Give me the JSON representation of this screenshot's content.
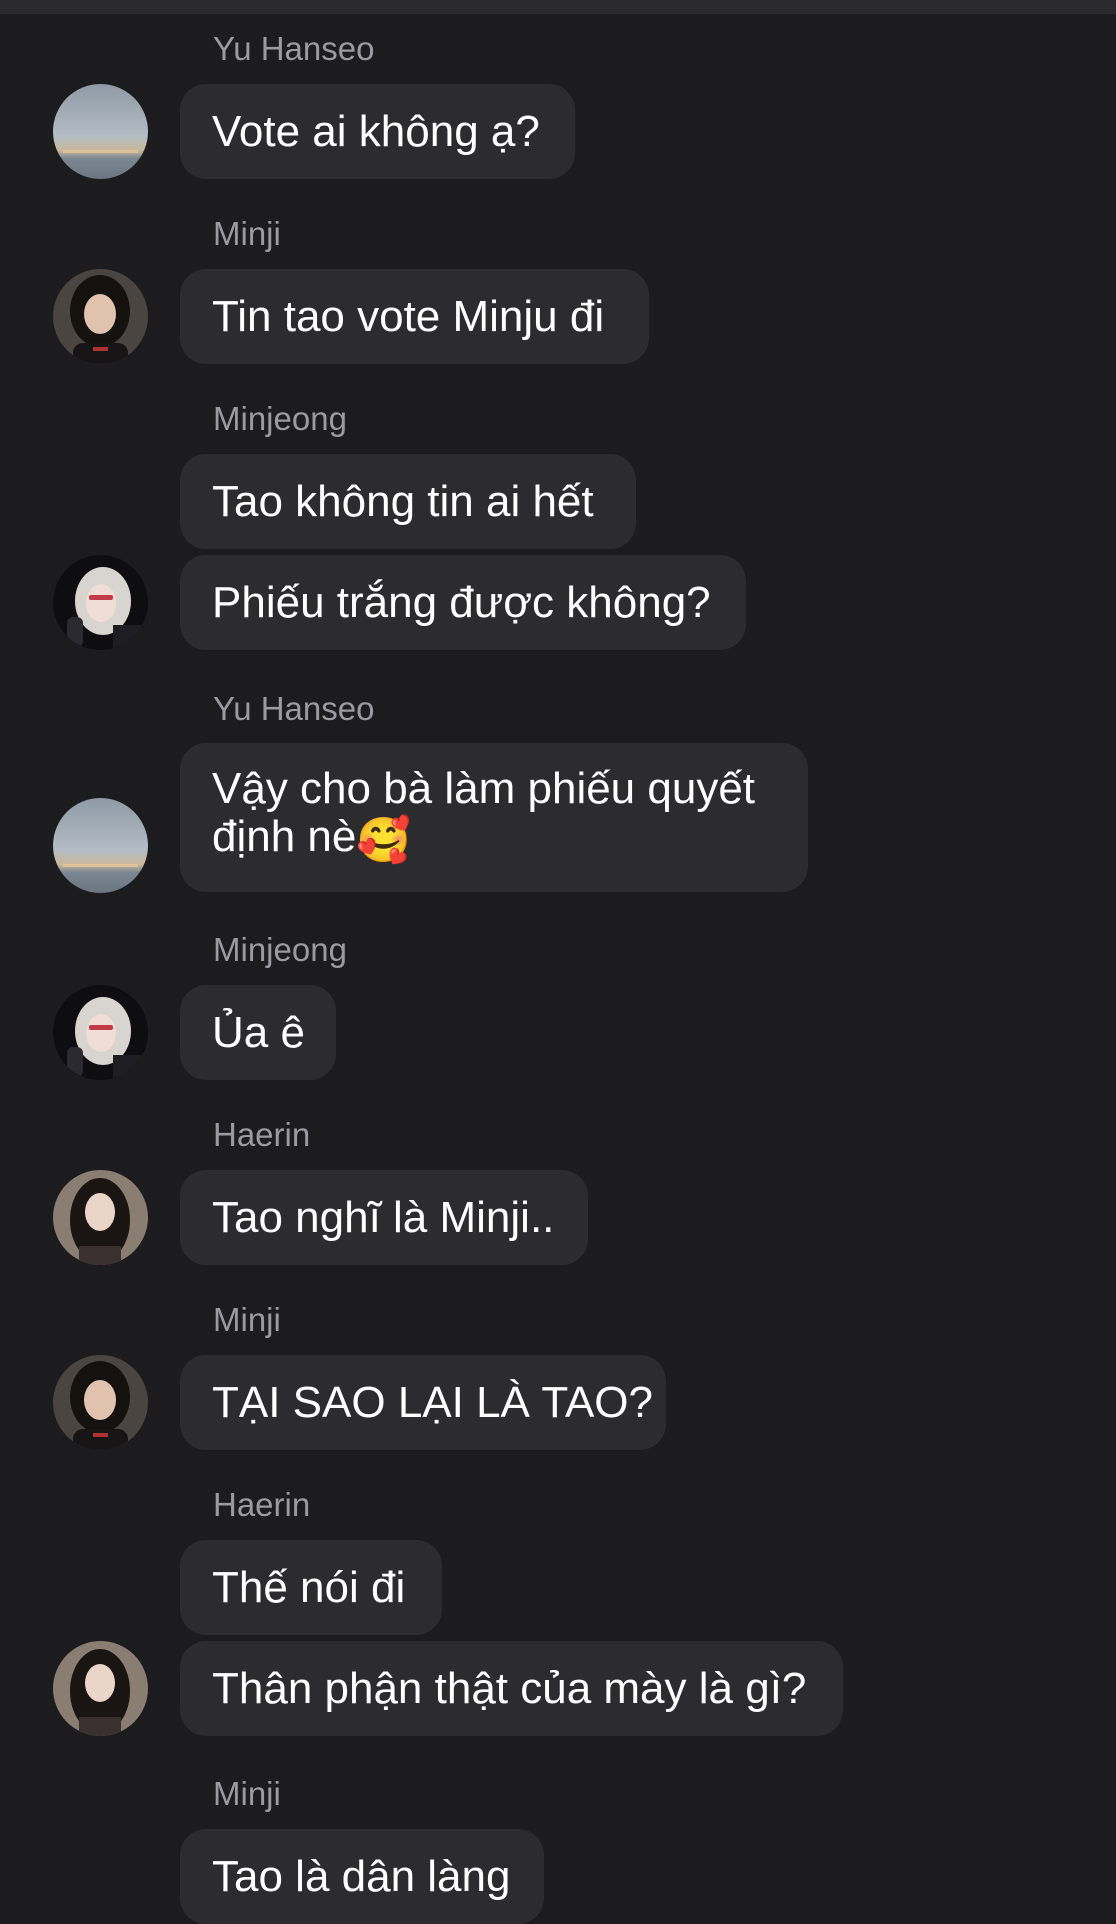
{
  "colors": {
    "background": "#1c1c1e",
    "bubble": "#2c2c2e",
    "sender_name": "#9a9aa0",
    "message_text": "#ffffff"
  },
  "messages": [
    {
      "sender": "Yu Hanseo",
      "text": "Vote ai không ạ?",
      "avatar": "sky-avatar-icon"
    },
    {
      "sender": "Minji",
      "text": "Tin tao vote Minju đi",
      "avatar": "dark-hair-girl-avatar-icon"
    },
    {
      "sender": "Minjeong",
      "text": "Tao không tin ai hết",
      "avatar": ""
    },
    {
      "sender": "",
      "text": "Phiếu trắng được không?",
      "avatar": "blonde-girl-avatar-icon"
    },
    {
      "sender": "Yu Hanseo",
      "text": "Vậy cho bà làm phiếu quyết định nè",
      "emoji": "🥰",
      "avatar": "sky-avatar-icon"
    },
    {
      "sender": "Minjeong",
      "text": "Ủa ê",
      "avatar": "blonde-girl-avatar-icon"
    },
    {
      "sender": "Haerin",
      "text": "Tao nghĩ là Minji..",
      "avatar": "long-hair-girl-avatar-icon"
    },
    {
      "sender": "Minji",
      "text": "TẠI SAO LẠI LÀ TAO?",
      "avatar": "dark-hair-girl-avatar-icon"
    },
    {
      "sender": "Haerin",
      "text": "Thế nói đi",
      "avatar": ""
    },
    {
      "sender": "",
      "text": "Thân phận thật của mày là gì?",
      "avatar": "long-hair-girl-avatar-icon"
    },
    {
      "sender": "Minji",
      "text": "Tao là dân làng",
      "avatar": ""
    }
  ]
}
